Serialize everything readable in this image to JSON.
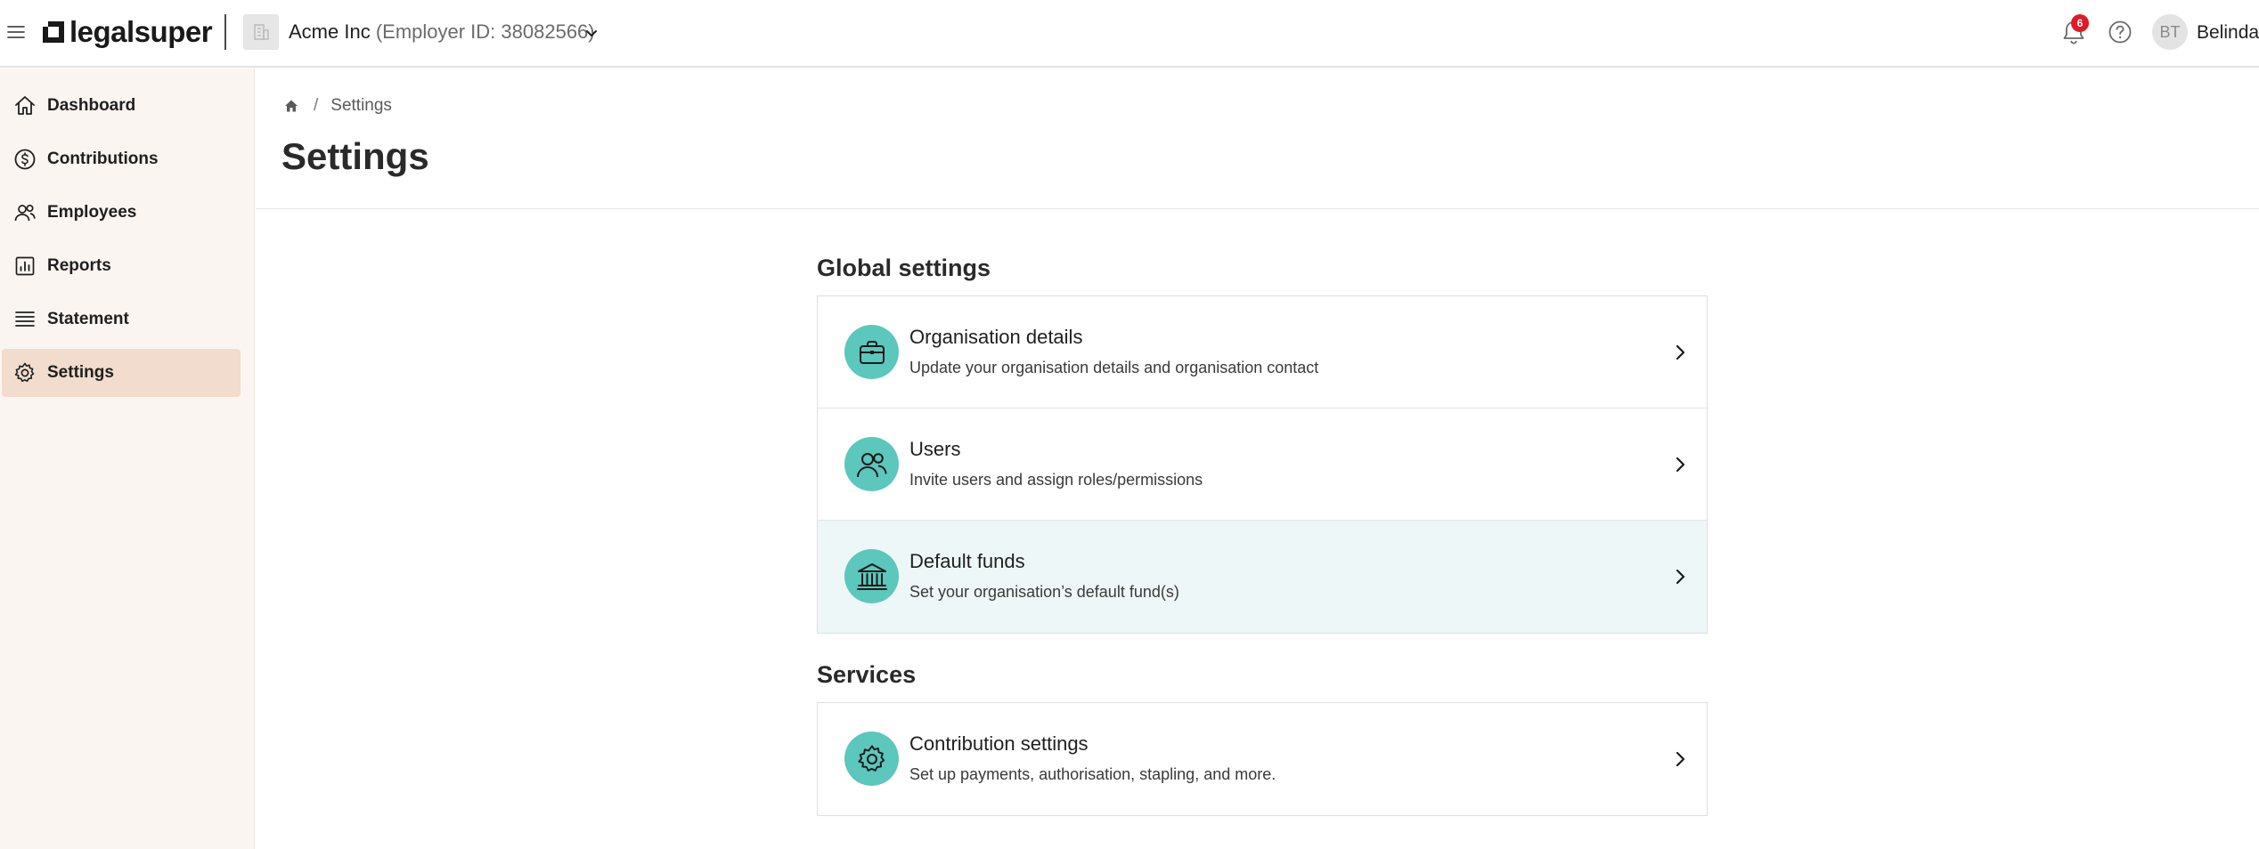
{
  "header": {
    "logo_text": "legalsuper",
    "org_name": "Acme Inc",
    "employer_id": "(Employer ID: 38082566)",
    "notification_count": "6",
    "avatar_initials": "BT",
    "user_name": "Belinda"
  },
  "sidebar": {
    "items": [
      {
        "label": "Dashboard",
        "icon": "home-icon"
      },
      {
        "label": "Contributions",
        "icon": "dollar-circle-icon"
      },
      {
        "label": "Employees",
        "icon": "people-icon"
      },
      {
        "label": "Reports",
        "icon": "bar-chart-icon"
      },
      {
        "label": "Statement",
        "icon": "list-icon"
      },
      {
        "label": "Settings",
        "icon": "gear-icon",
        "active": true
      }
    ]
  },
  "breadcrumb": {
    "current": "Settings"
  },
  "page": {
    "title": "Settings"
  },
  "global_settings": {
    "heading": "Global settings",
    "items": [
      {
        "title": "Organisation details",
        "description": "Update your organisation details and organisation contact",
        "icon": "briefcase-icon"
      },
      {
        "title": "Users",
        "description": "Invite users and assign roles/permissions",
        "icon": "users-icon"
      },
      {
        "title": "Default funds",
        "description": "Set your organisation’s default fund(s)",
        "icon": "bank-icon"
      }
    ]
  },
  "services": {
    "heading": "Services",
    "items": [
      {
        "title": "Contribution settings",
        "description": "Set up payments, authorisation, stapling, and more.",
        "icon": "gear-icon"
      }
    ]
  },
  "colors": {
    "accent_teal": "#5cc7bc",
    "sidebar_bg": "#fbf5f1",
    "sidebar_active": "#f1dccd",
    "badge_red": "#e01b24",
    "row_hover": "#eef7f7"
  }
}
